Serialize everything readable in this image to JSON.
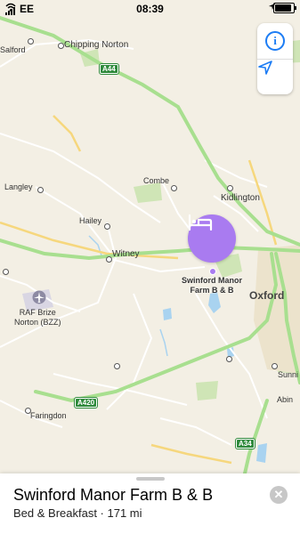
{
  "status_bar": {
    "carrier": "EE",
    "time": "08:39"
  },
  "map": {
    "place_labels": {
      "salford": "Salford",
      "chipping_norton": "Chipping Norton",
      "langley": "Langley",
      "combe": "Combe",
      "kidlington": "Kidlington",
      "hailey": "Hailey",
      "witney": "Witney",
      "oxford": "Oxford",
      "raf_brize_norton": "RAF Brize\nNorton (BZZ)",
      "faringdon": "Faringdon",
      "sunni": "Sunni",
      "abin": "Abin"
    },
    "road_shields": {
      "a44": "A44",
      "a420": "A420",
      "a34": "A34"
    }
  },
  "pin": {
    "label": "Swinford Manor\nFarm B & B",
    "icon": "bed-icon",
    "color": "#a97bf0"
  },
  "sheet": {
    "title": "Swinford Manor Farm B & B",
    "subtitle": "Bed & Breakfast · 171 mi"
  },
  "colors": {
    "accent": "#1c7cf4",
    "major_road": "#a8df8f",
    "shield": "#2f8a3c"
  }
}
